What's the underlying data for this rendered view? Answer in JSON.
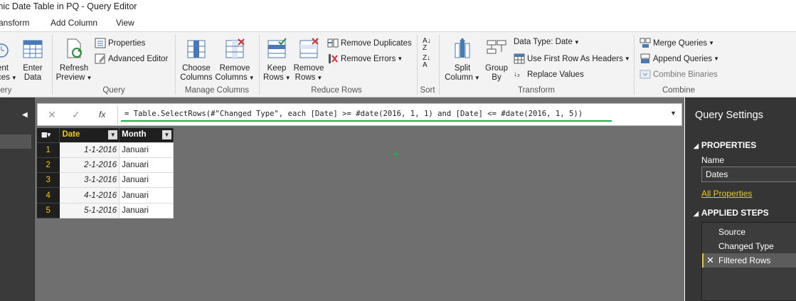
{
  "window": {
    "title": "mic Date Table in PQ - Query Editor"
  },
  "menu": {
    "items": [
      "ransform",
      "Add Column",
      "View"
    ]
  },
  "ribbon": {
    "groups": {
      "query_partial": "uery",
      "query": "Query",
      "manage_columns": "Manage Columns",
      "reduce_rows": "Reduce Rows",
      "sort": "Sort",
      "transform": "Transform",
      "combine": "Combine"
    },
    "recent": {
      "line1": "ent",
      "line2": "ces"
    },
    "enter_data": {
      "line1": "Enter",
      "line2": "Data"
    },
    "refresh_preview": {
      "line1": "Refresh",
      "line2": "Preview"
    },
    "properties": "Properties",
    "advanced_editor": "Advanced Editor",
    "choose_columns": {
      "line1": "Choose",
      "line2": "Columns"
    },
    "remove_columns": {
      "line1": "Remove",
      "line2": "Columns"
    },
    "keep_rows": {
      "line1": "Keep",
      "line2": "Rows"
    },
    "remove_rows": {
      "line1": "Remove",
      "line2": "Rows"
    },
    "remove_duplicates": "Remove Duplicates",
    "remove_errors": "Remove Errors",
    "split_column": {
      "line1": "Split",
      "line2": "Column"
    },
    "group_by": {
      "line1": "Group",
      "line2": "By"
    },
    "data_type": "Data Type: Date",
    "use_first_row": "Use First Row As Headers",
    "replace_values": "Replace Values",
    "merge_queries": "Merge Queries",
    "append_queries": "Append Queries",
    "combine_binaries": "Combine Binaries"
  },
  "formula_bar": {
    "cancel": "✕",
    "confirm": "✓",
    "fx": "fx",
    "formula": "= Table.SelectRows(#\"Changed Type\", each [Date] >= #date(2016, 1, 1) and [Date] <= #date(2016, 1, 5))"
  },
  "table": {
    "columns": [
      "Date",
      "Month"
    ],
    "rows": [
      {
        "index": "1",
        "date": "1-1-2016",
        "month": "Januari"
      },
      {
        "index": "2",
        "date": "2-1-2016",
        "month": "Januari"
      },
      {
        "index": "3",
        "date": "3-1-2016",
        "month": "Januari"
      },
      {
        "index": "4",
        "date": "4-1-2016",
        "month": "Januari"
      },
      {
        "index": "5",
        "date": "5-1-2016",
        "month": "Januari"
      }
    ]
  },
  "query_settings": {
    "title": "Query Settings",
    "properties_header": "PROPERTIES",
    "name_label": "Name",
    "name_value": "Dates",
    "all_properties": "All Properties",
    "applied_steps_header": "APPLIED STEPS",
    "steps": [
      "Source",
      "Changed Type",
      "Filtered Rows"
    ]
  },
  "colors": {
    "accent": "#f2c811",
    "underline": "#1faa4a",
    "canvas": "#6f6f6f",
    "panel": "#353535"
  }
}
